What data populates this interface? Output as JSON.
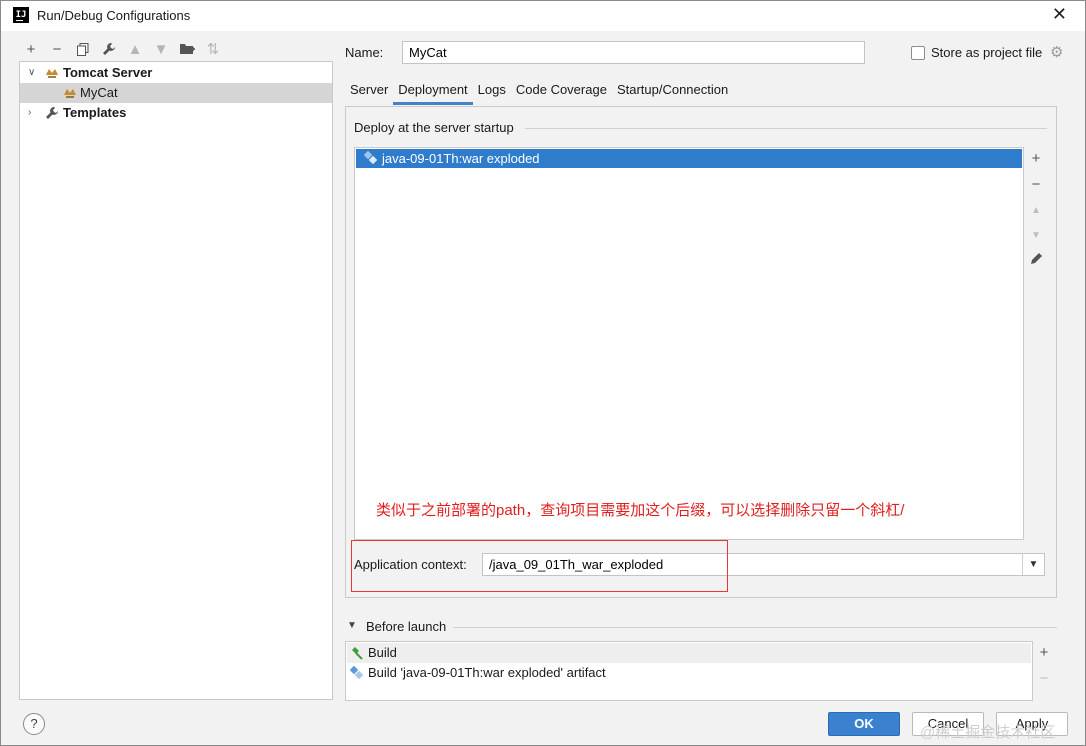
{
  "window": {
    "title": "Run/Debug Configurations"
  },
  "toolbar": {
    "items": [
      "add-icon",
      "remove-icon",
      "copy-icon",
      "wrench-icon",
      "move-up-icon",
      "move-down-icon",
      "folder-icon",
      "sort-icon"
    ]
  },
  "tree": {
    "items": [
      {
        "label": "Tomcat Server",
        "expanded": true
      },
      {
        "label": "MyCat",
        "selected": true
      },
      {
        "label": "Templates",
        "expanded": false
      }
    ]
  },
  "name_field": {
    "label": "Name:",
    "value": "MyCat"
  },
  "store_as_project_file": {
    "label": "Store as project file",
    "checked": false
  },
  "tabs": [
    {
      "label": "Server"
    },
    {
      "label": "Deployment",
      "active": true
    },
    {
      "label": "Logs"
    },
    {
      "label": "Code Coverage"
    },
    {
      "label": "Startup/Connection"
    }
  ],
  "deployment": {
    "section_title": "Deploy at the server startup",
    "items": [
      "java-09-01Th:war exploded"
    ],
    "annotation": "类似于之前部署的path，查询项目需要加这个后缀，可以选择删除只留一个斜杠/",
    "app_context": {
      "label": "Application context:",
      "value": "/java_09_01Th_war_exploded"
    }
  },
  "before_launch": {
    "title": "Before launch",
    "items": [
      {
        "label": "Build"
      },
      {
        "label": "Build 'java-09-01Th:war exploded' artifact"
      }
    ]
  },
  "buttons": {
    "ok": "OK",
    "cancel": "Cancel",
    "apply": "Apply",
    "help": "?"
  },
  "watermark": "@稀土掘金技术社区",
  "colors": {
    "accent": "#3a81d0",
    "selection": "#2f7ccd",
    "annotation": "#e02020"
  }
}
